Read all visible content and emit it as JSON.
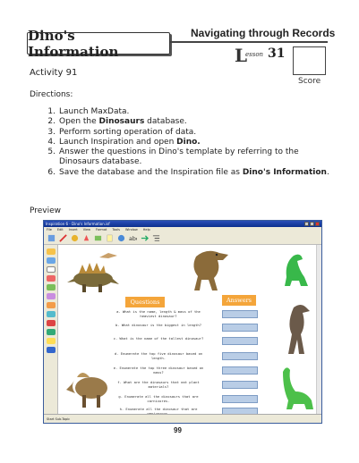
{
  "header": {
    "section_title": "Navigating through Records",
    "page_heading": "Dino's Information",
    "lesson_word": "esson",
    "lesson_letter": "L",
    "lesson_number": "31",
    "score_label": "Score"
  },
  "activity": "Activity 91",
  "directions_label": "Directions:",
  "steps": [
    {
      "n": "1.",
      "pre": "Launch MaxData.",
      "bold": "",
      "post": ""
    },
    {
      "n": "2.",
      "pre": "Open the ",
      "bold": "Dinosaurs",
      "post": " database."
    },
    {
      "n": "3.",
      "pre": "Perform sorting operation of data.",
      "bold": "",
      "post": ""
    },
    {
      "n": "4.",
      "pre": "Launch Inspiration and open ",
      "bold": "Dino.",
      "post": ""
    },
    {
      "n": "5.",
      "pre": "Answer the questions in Dino's template by referring to the Dinosaurs database.",
      "bold": "",
      "post": ""
    },
    {
      "n": "6.",
      "pre": "Save the database and the Inspiration file as ",
      "bold": "Dino's Information",
      "post": "."
    }
  ],
  "preview_label": "Preview",
  "app": {
    "window_title": "Inspiration 6 - Dino's Information.isf",
    "menus": [
      "File",
      "Edit",
      "Insert",
      "View",
      "Format",
      "Tools",
      "Window",
      "Help"
    ],
    "status_text": "Start Sub-Topic",
    "questions_header": "Questions",
    "answers_header": "Answers",
    "questions": [
      "a. What is the name, length & mass of the heaviest dinosaur?",
      "b. What dinosaur is the biggest in length?",
      "c. What is the name of the tallest dinosaur?",
      "d. Enumerate the top five dinosaur based on length.",
      "e. Enumerate the top three dinosaur based on mass?",
      "f. What are the dinosaurs that eat plant materials?",
      "g. Enumerate all the dinosaurs that are carnivores.",
      "h. Enumerate all the dinosaur that are omnivorous."
    ]
  },
  "page_number": "99",
  "colors": {
    "orange": "#f4a53a",
    "answer_box": "#b9cde6",
    "titlebar": "#0c2f8e"
  }
}
